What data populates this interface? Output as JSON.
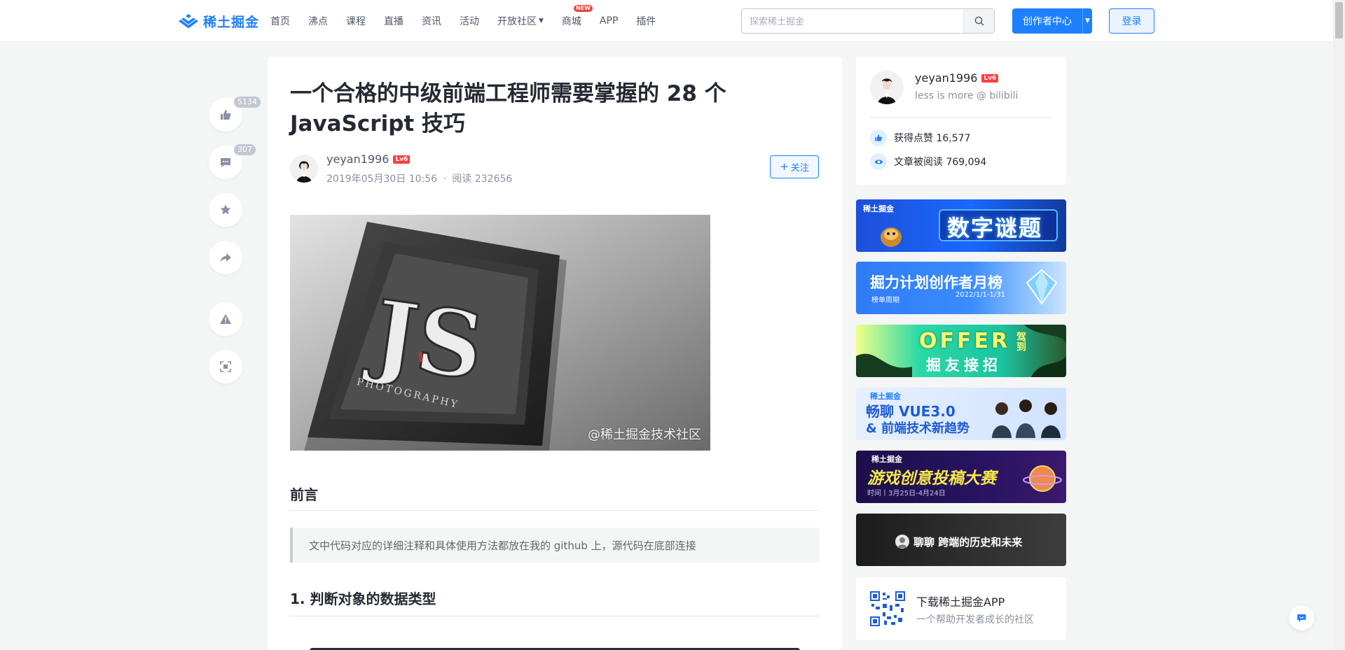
{
  "header": {
    "logo_text": "稀土掘金",
    "nav": [
      {
        "label": "首页"
      },
      {
        "label": "沸点"
      },
      {
        "label": "课程"
      },
      {
        "label": "直播"
      },
      {
        "label": "资讯"
      },
      {
        "label": "活动"
      },
      {
        "label": "开放社区"
      },
      {
        "label": "商城",
        "badge": "NEW"
      },
      {
        "label": "APP"
      },
      {
        "label": "插件"
      }
    ],
    "search_placeholder": "探索稀土掘金",
    "creator_label": "创作者中心",
    "login_label": "登录"
  },
  "side_actions": {
    "like_count": "5134",
    "comment_count": "307"
  },
  "article": {
    "title": "一个合格的中级前端工程师需要掌握的 28 个 JavaScript 技巧",
    "author": "yeyan1996",
    "level": "Lv6",
    "date": "2019年05月30日 10:56",
    "reads": "阅读 232656",
    "separator": "·",
    "follow_label": "关注",
    "cover_watermark": "@稀土掘金技术社区",
    "section1": "前言",
    "quote": "文中代码对应的详细注释和具体使用方法都放在我的 github 上，源代码在底部连接",
    "section2": "1. 判断对象的数据类型"
  },
  "author_card": {
    "name": "yeyan1996",
    "level": "Lv6",
    "desc": "less is more @ bilibili",
    "likes": "获得点赞 16,577",
    "reads": "文章被阅读 769,094"
  },
  "banners": [
    {
      "brand": "稀土掘金",
      "title": "数字谜题"
    },
    {
      "brand": "稀土掘金",
      "title": "掘力计划创作者月榜",
      "sub": "榜单周期",
      "date": "2022/1/1-1/31"
    },
    {
      "title": "OFFER",
      "title2": "掘友接招",
      "side": "驾到"
    },
    {
      "brand": "稀土掘金",
      "title": "畅聊 VUE3.0",
      "title2": "& 前端技术新趋势"
    },
    {
      "brand": "稀土掘金",
      "title": "游戏创意投稿大赛",
      "sub": "时间丨3月25日-4月24日"
    },
    {
      "title": "聊聊 跨端的历史和未来"
    }
  ],
  "app_card": {
    "title": "下载稀土掘金APP",
    "sub": "一个帮助开发者成长的社区"
  },
  "colors": {
    "brand": "#1e80ff",
    "level_badge": "#ff3e3e",
    "new_badge": "#f53f3f"
  }
}
